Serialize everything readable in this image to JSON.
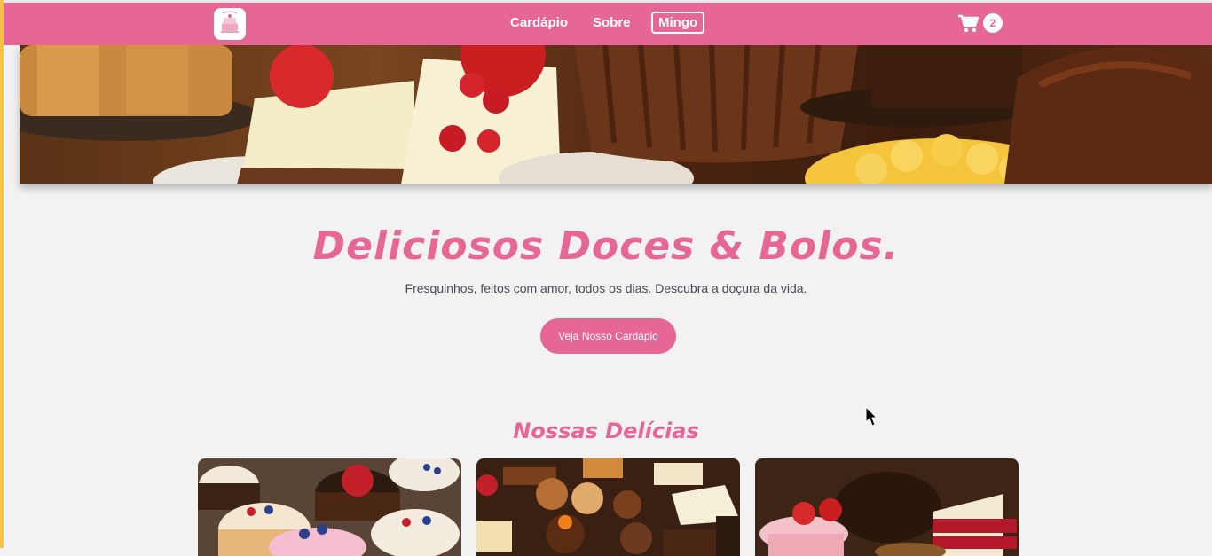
{
  "nav": {
    "links": [
      "Cardápio",
      "Sobre"
    ],
    "user": "Mingo",
    "cart_count": "2"
  },
  "hero": {
    "title": "Deliciosos Doces & Bolos.",
    "subtitle": "Fresquinhos, feitos com amor, todos os dias. Descubra a doçura da vida.",
    "cta_label": "Veja Nosso Cardápio"
  },
  "section": {
    "title": "Nossas Delícias"
  },
  "colors": {
    "brand_pink": "#e66795",
    "background": "#f2f2f2",
    "text": "#444a55"
  },
  "icons": [
    "logo-icon",
    "cart-icon",
    "mouse-cursor-icon"
  ]
}
